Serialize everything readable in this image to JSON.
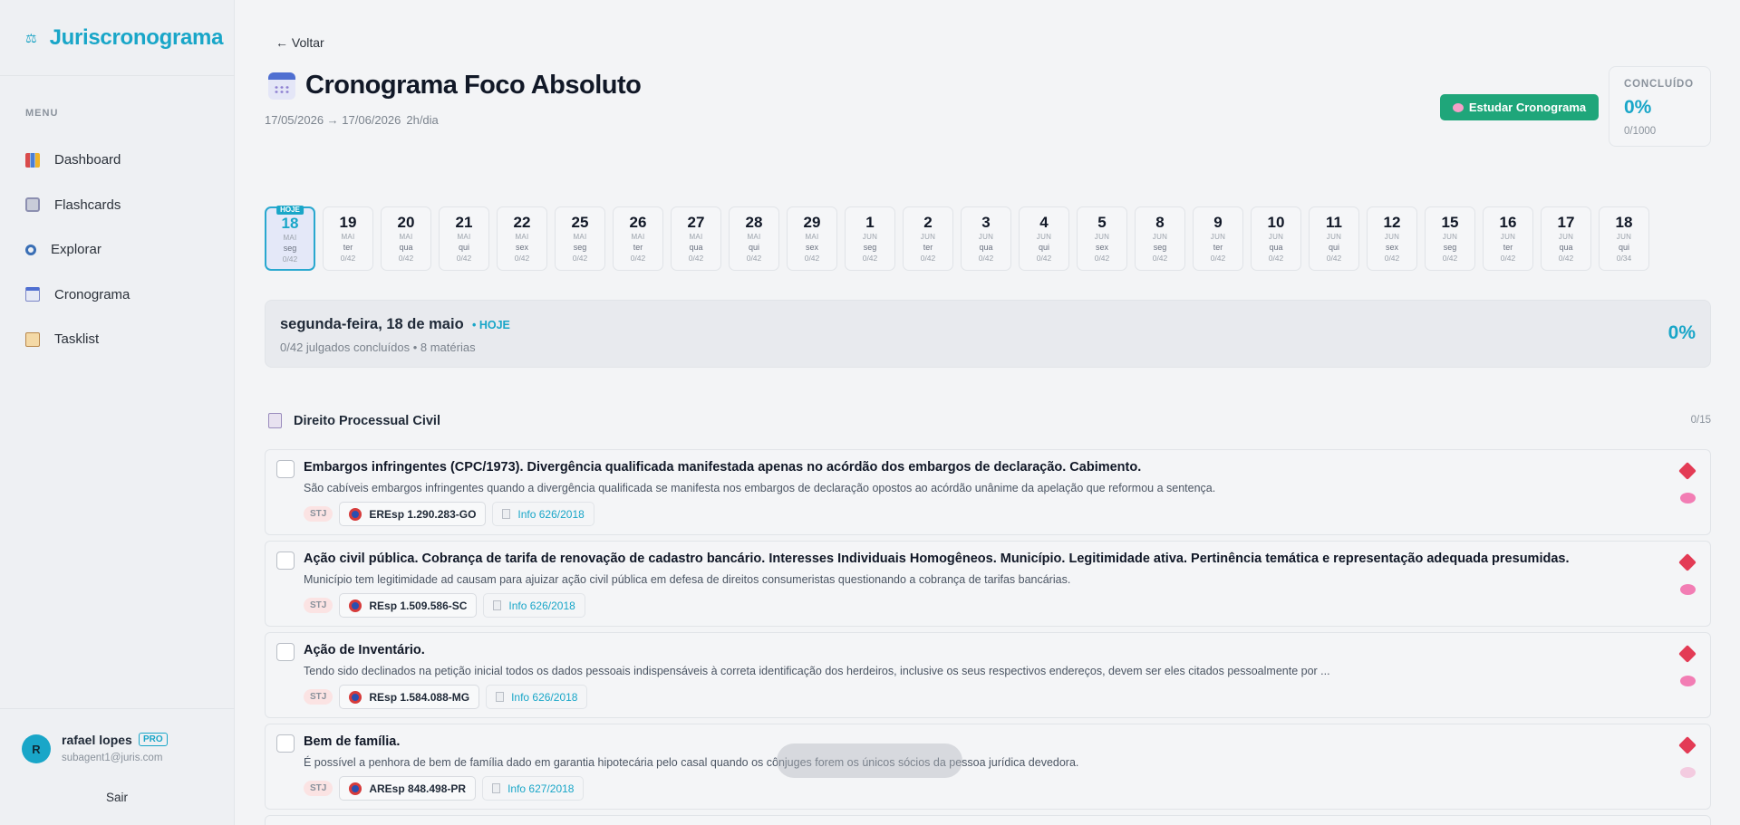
{
  "sidebar": {
    "brand": "Juriscronograma",
    "menu_label": "MENU",
    "items": [
      {
        "label": "Dashboard",
        "icon": "chart-icon"
      },
      {
        "label": "Flashcards",
        "icon": "cards-icon"
      },
      {
        "label": "Explorar",
        "icon": "search-icon"
      },
      {
        "label": "Cronograma",
        "icon": "calendar-icon"
      },
      {
        "label": "Tasklist",
        "icon": "clipboard-icon"
      }
    ],
    "user": {
      "initial": "R",
      "name": "rafael lopes",
      "badge": "PRO",
      "email": "subagent1@juris.com",
      "logout": "Sair"
    }
  },
  "header": {
    "back": "← Voltar",
    "title": "Cronograma Foco Absoluto",
    "dates": "17/05/2026 → 17/06/2026",
    "hours": "2h/dia",
    "study_button": "Estudar Cronograma",
    "done": {
      "label": "CONCLUÍDO",
      "percent": "0%",
      "count": "0/1000"
    }
  },
  "days": [
    {
      "num": "18",
      "mon": "MAI",
      "wk": "seg",
      "prog": "0/42",
      "today": true,
      "tag": "HOJE"
    },
    {
      "num": "19",
      "mon": "MAI",
      "wk": "ter",
      "prog": "0/42"
    },
    {
      "num": "20",
      "mon": "MAI",
      "wk": "qua",
      "prog": "0/42"
    },
    {
      "num": "21",
      "mon": "MAI",
      "wk": "qui",
      "prog": "0/42"
    },
    {
      "num": "22",
      "mon": "MAI",
      "wk": "sex",
      "prog": "0/42"
    },
    {
      "num": "25",
      "mon": "MAI",
      "wk": "seg",
      "prog": "0/42"
    },
    {
      "num": "26",
      "mon": "MAI",
      "wk": "ter",
      "prog": "0/42"
    },
    {
      "num": "27",
      "mon": "MAI",
      "wk": "qua",
      "prog": "0/42"
    },
    {
      "num": "28",
      "mon": "MAI",
      "wk": "qui",
      "prog": "0/42"
    },
    {
      "num": "29",
      "mon": "MAI",
      "wk": "sex",
      "prog": "0/42"
    },
    {
      "num": "1",
      "mon": "JUN",
      "wk": "seg",
      "prog": "0/42"
    },
    {
      "num": "2",
      "mon": "JUN",
      "wk": "ter",
      "prog": "0/42"
    },
    {
      "num": "3",
      "mon": "JUN",
      "wk": "qua",
      "prog": "0/42"
    },
    {
      "num": "4",
      "mon": "JUN",
      "wk": "qui",
      "prog": "0/42"
    },
    {
      "num": "5",
      "mon": "JUN",
      "wk": "sex",
      "prog": "0/42"
    },
    {
      "num": "8",
      "mon": "JUN",
      "wk": "seg",
      "prog": "0/42"
    },
    {
      "num": "9",
      "mon": "JUN",
      "wk": "ter",
      "prog": "0/42"
    },
    {
      "num": "10",
      "mon": "JUN",
      "wk": "qua",
      "prog": "0/42"
    },
    {
      "num": "11",
      "mon": "JUN",
      "wk": "qui",
      "prog": "0/42"
    },
    {
      "num": "12",
      "mon": "JUN",
      "wk": "sex",
      "prog": "0/42"
    },
    {
      "num": "15",
      "mon": "JUN",
      "wk": "seg",
      "prog": "0/42"
    },
    {
      "num": "16",
      "mon": "JUN",
      "wk": "ter",
      "prog": "0/42"
    },
    {
      "num": "17",
      "mon": "JUN",
      "wk": "qua",
      "prog": "0/42"
    },
    {
      "num": "18",
      "mon": "JUN",
      "wk": "qui",
      "prog": "0/34"
    }
  ],
  "summary": {
    "title": "segunda-feira, 18 de maio",
    "today": "• HOJE",
    "sub": "0/42 julgados concluídos • 8 matérias",
    "percent": "0%"
  },
  "subject": {
    "title": "Direito Processual Civil",
    "count": "0/15"
  },
  "cards": [
    {
      "title": "Embargos infringentes (CPC/1973). Divergência qualificada manifestada apenas no acórdão dos embargos de declaração. Cabimento.",
      "desc": "São cabíveis embargos infringentes quando a divergência qualificada se manifesta nos embargos de declaração opostos ao acórdão unânime da apelação que reformou a sentença.",
      "court": "STJ",
      "process": "EREsp 1.290.283-GO",
      "info": "Info 626/2018"
    },
    {
      "title": "Ação civil pública. Cobrança de tarifa de renovação de cadastro bancário. Interesses Individuais Homogêneos. Município. Legitimidade ativa. Pertinência temática e representação adequada presumidas.",
      "desc": "Município tem legitimidade ad causam para ajuizar ação civil pública em defesa de direitos consumeristas questionando a cobrança de tarifas bancárias.",
      "court": "STJ",
      "process": "REsp 1.509.586-SC",
      "info": "Info 626/2018"
    },
    {
      "title": "Ação de Inventário.",
      "desc": "Tendo sido declinados na petição inicial todos os dados pessoais indispensáveis à correta identificação dos herdeiros, inclusive os seus respectivos endereços, devem ser eles citados pessoalmente por ...",
      "court": "STJ",
      "process": "REsp 1.584.088-MG",
      "info": "Info 626/2018"
    },
    {
      "title": "Bem de família.",
      "desc": "É possível a penhora de bem de família dado em garantia hipotecária pelo casal quando os cônjuges forem os únicos sócios da pessoa jurídica devedora.",
      "court": "STJ",
      "process": "AREsp 848.498-PR",
      "info": "Info 627/2018"
    }
  ]
}
